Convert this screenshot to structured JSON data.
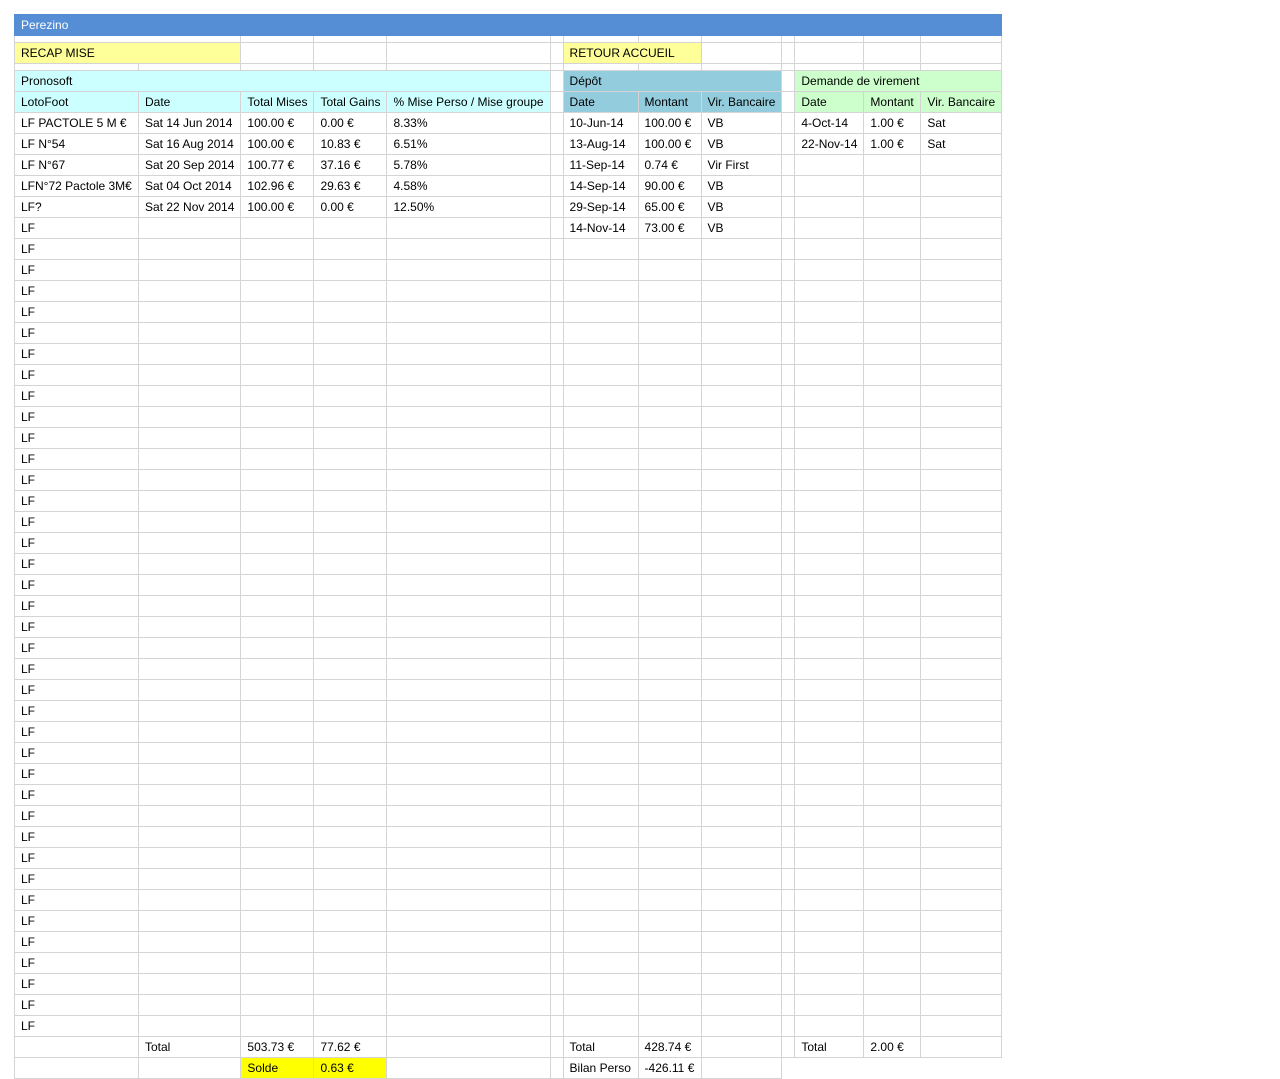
{
  "sheet_title": "Perezino",
  "buttons": {
    "recap": "RECAP MISE",
    "retour": "RETOUR ACCUEIL"
  },
  "colors": {
    "title_bar": "#558ed5",
    "button": "#ffff99",
    "pronosoft": "#ccffff",
    "depot": "#93cddd",
    "virement": "#ccffcc",
    "solde": "#ffff00"
  },
  "pronosoft": {
    "title": "Pronosoft",
    "headers": [
      "LotoFoot",
      "Date",
      "Total Mises",
      "Total Gains",
      "% Mise Perso / Mise groupe"
    ],
    "rows": [
      [
        "LF PACTOLE 5 M €",
        "Sat 14 Jun 2014",
        "100.00 €",
        "0.00 €",
        "8.33%"
      ],
      [
        "LF N°54",
        "Sat 16 Aug 2014",
        "100.00 €",
        "10.83 €",
        "6.51%"
      ],
      [
        "LF N°67",
        "Sat 20 Sep 2014",
        "100.77 €",
        "37.16 €",
        "5.78%"
      ],
      [
        "LFN°72 Pactole 3M€",
        "Sat 04 Oct 2014",
        "102.96 €",
        "29.63 €",
        "4.58%"
      ],
      [
        "LF?",
        "Sat 22 Nov 2014",
        "100.00 €",
        "0.00 €",
        "12.50%"
      ],
      [
        "LF",
        "",
        "",
        "",
        ""
      ],
      [
        "LF",
        "",
        "",
        "",
        ""
      ],
      [
        "LF",
        "",
        "",
        "",
        ""
      ],
      [
        "LF",
        "",
        "",
        "",
        ""
      ],
      [
        "LF",
        "",
        "",
        "",
        ""
      ],
      [
        "LF",
        "",
        "",
        "",
        ""
      ],
      [
        "LF",
        "",
        "",
        "",
        ""
      ],
      [
        "LF",
        "",
        "",
        "",
        ""
      ],
      [
        "LF",
        "",
        "",
        "",
        ""
      ],
      [
        "LF",
        "",
        "",
        "",
        ""
      ],
      [
        "LF",
        "",
        "",
        "",
        ""
      ],
      [
        "LF",
        "",
        "",
        "",
        ""
      ],
      [
        "LF",
        "",
        "",
        "",
        ""
      ],
      [
        "LF",
        "",
        "",
        "",
        ""
      ],
      [
        "LF",
        "",
        "",
        "",
        ""
      ],
      [
        "LF",
        "",
        "",
        "",
        ""
      ],
      [
        "LF",
        "",
        "",
        "",
        ""
      ],
      [
        "LF",
        "",
        "",
        "",
        ""
      ],
      [
        "LF",
        "",
        "",
        "",
        ""
      ],
      [
        "LF",
        "",
        "",
        "",
        ""
      ],
      [
        "LF",
        "",
        "",
        "",
        ""
      ],
      [
        "LF",
        "",
        "",
        "",
        ""
      ],
      [
        "LF",
        "",
        "",
        "",
        ""
      ],
      [
        "LF",
        "",
        "",
        "",
        ""
      ],
      [
        "LF",
        "",
        "",
        "",
        ""
      ],
      [
        "LF",
        "",
        "",
        "",
        ""
      ],
      [
        "LF",
        "",
        "",
        "",
        ""
      ],
      [
        "LF",
        "",
        "",
        "",
        ""
      ],
      [
        "LF",
        "",
        "",
        "",
        ""
      ],
      [
        "LF",
        "",
        "",
        "",
        ""
      ],
      [
        "LF",
        "",
        "",
        "",
        ""
      ],
      [
        "LF",
        "",
        "",
        "",
        ""
      ],
      [
        "LF",
        "",
        "",
        "",
        ""
      ],
      [
        "LF",
        "",
        "",
        "",
        ""
      ],
      [
        "LF",
        "",
        "",
        "",
        ""
      ],
      [
        "LF",
        "",
        "",
        "",
        ""
      ],
      [
        "LF",
        "",
        "",
        "",
        ""
      ],
      [
        "LF",
        "",
        "",
        "",
        ""
      ],
      [
        "LF",
        "",
        "",
        "",
        ""
      ]
    ],
    "total_label": "Total",
    "total_mises": "503.73 €",
    "total_gains": "77.62 €",
    "solde_label": "Solde",
    "solde_value": "0.63 €"
  },
  "depot": {
    "title": "Dépôt",
    "headers": [
      "Date",
      "Montant",
      "Vir. Bancaire"
    ],
    "rows": [
      [
        "10-Jun-14",
        "100.00 €",
        "VB"
      ],
      [
        "13-Aug-14",
        "100.00 €",
        "VB"
      ],
      [
        "11-Sep-14",
        "0.74 €",
        "Vir First"
      ],
      [
        "14-Sep-14",
        "90.00 €",
        "VB"
      ],
      [
        "29-Sep-14",
        "65.00 €",
        "VB"
      ],
      [
        "14-Nov-14",
        "73.00 €",
        "VB"
      ]
    ],
    "total_label": "Total",
    "total_value": "428.74 €",
    "bilan_label": "Bilan Perso",
    "bilan_value": "-426.11 €"
  },
  "virement": {
    "title": "Demande de virement",
    "headers": [
      "Date",
      "Montant",
      "Vir. Bancaire"
    ],
    "rows": [
      [
        "4-Oct-14",
        "1.00 €",
        "Sat"
      ],
      [
        "22-Nov-14",
        "1.00 €",
        "Sat"
      ]
    ],
    "total_label": "Total",
    "total_value": "2.00 €"
  }
}
